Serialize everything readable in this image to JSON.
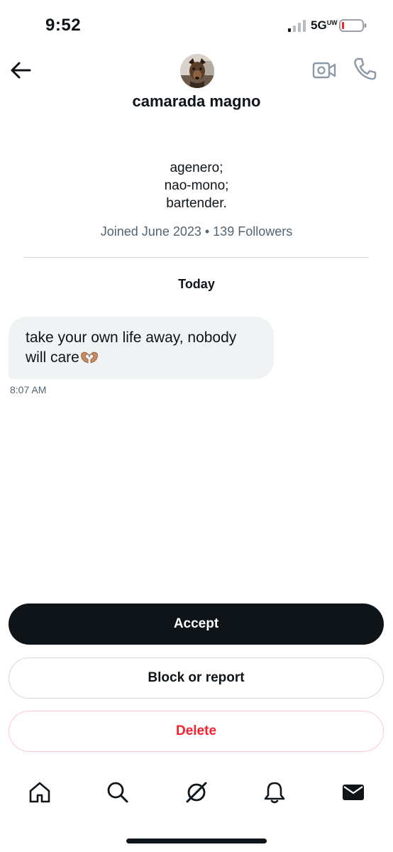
{
  "status_bar": {
    "time": "9:52",
    "network": "5G",
    "network_sup": "UW"
  },
  "header": {
    "display_name": "camarada magno"
  },
  "profile": {
    "bio_lines": [
      "agenero;",
      "nao-mono;",
      "bartender."
    ],
    "meta": "Joined June 2023 • 139 Followers"
  },
  "conversation": {
    "date_label": "Today",
    "messages": [
      {
        "text": "take your own life away, nobody will care",
        "emoji": "heart-hands",
        "time": "8:07 AM"
      }
    ]
  },
  "actions": {
    "accept_label": "Accept",
    "block_label": "Block or report",
    "delete_label": "Delete"
  },
  "tabbar": {
    "items": [
      "home-icon",
      "search-icon",
      "grok-icon",
      "notifications-icon",
      "messages-icon"
    ]
  },
  "colors": {
    "primary_text": "#0f1419",
    "secondary_text": "#536471",
    "bubble_bg": "#eff3f4",
    "danger": "#f4212e",
    "battery_low": "#f4212e"
  }
}
